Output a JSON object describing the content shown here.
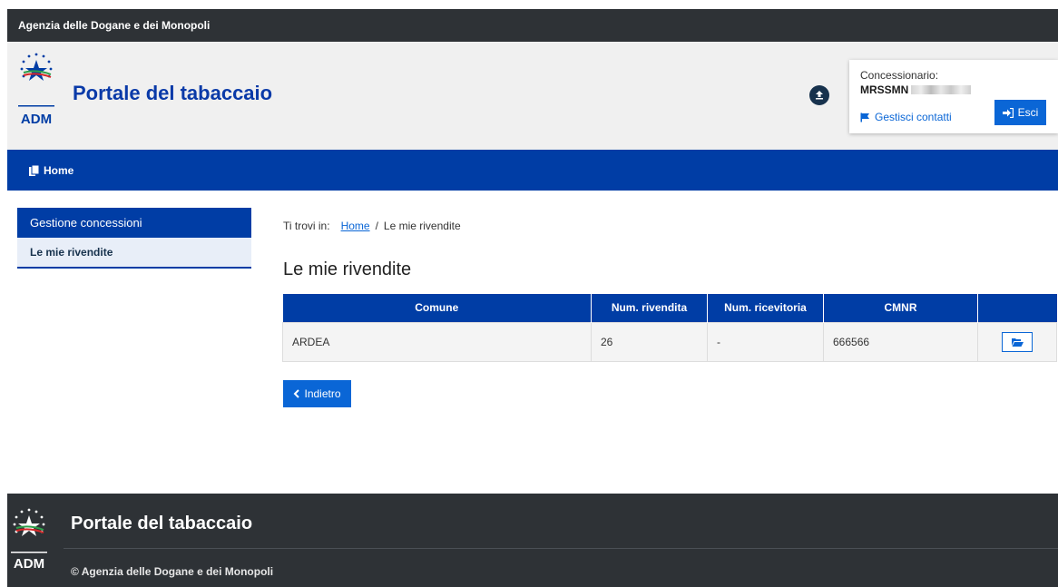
{
  "topbar": {
    "agency_name": "Agenzia delle Dogane e dei Monopoli"
  },
  "header": {
    "logo_text": "ADM",
    "portal_title": "Portale del tabaccaio",
    "user": {
      "role_label": "Concessionario:",
      "code": "MRSSMN",
      "contacts_label": "Gestisci contatti",
      "exit_label": "Esci"
    }
  },
  "nav": {
    "home_label": "Home"
  },
  "sidebar": {
    "section_title": "Gestione concessioni",
    "items": [
      {
        "label": "Le mie rivendite"
      }
    ]
  },
  "breadcrumb": {
    "prefix": "Ti trovi in:",
    "home": "Home",
    "separator": "/",
    "current": "Le mie rivendite"
  },
  "main": {
    "title": "Le mie rivendite",
    "table": {
      "headers": [
        "Comune",
        "Num. rivendita",
        "Num. ricevitoria",
        "CMNR",
        ""
      ],
      "rows": [
        {
          "comune": "ARDEA",
          "num_rivendita": "26",
          "num_ricevitoria": "-",
          "cmnr": "666566"
        }
      ]
    },
    "back_label": "Indietro"
  },
  "footer": {
    "logo_text": "ADM",
    "title": "Portale del tabaccaio",
    "copyright": "© Agenzia delle Dogane e dei Monopoli"
  },
  "colors": {
    "primary_blue": "#003da5",
    "link_blue": "#0a66d6",
    "dark_bar": "#2e3236",
    "header_bg": "#f0f0f0"
  },
  "icons": {
    "upload": "upload-circle-icon",
    "flag": "flag-icon",
    "sign_in": "sign-in-icon",
    "home": "files-icon",
    "folder": "folder-open-icon",
    "chevron": "chevron-left-icon"
  }
}
